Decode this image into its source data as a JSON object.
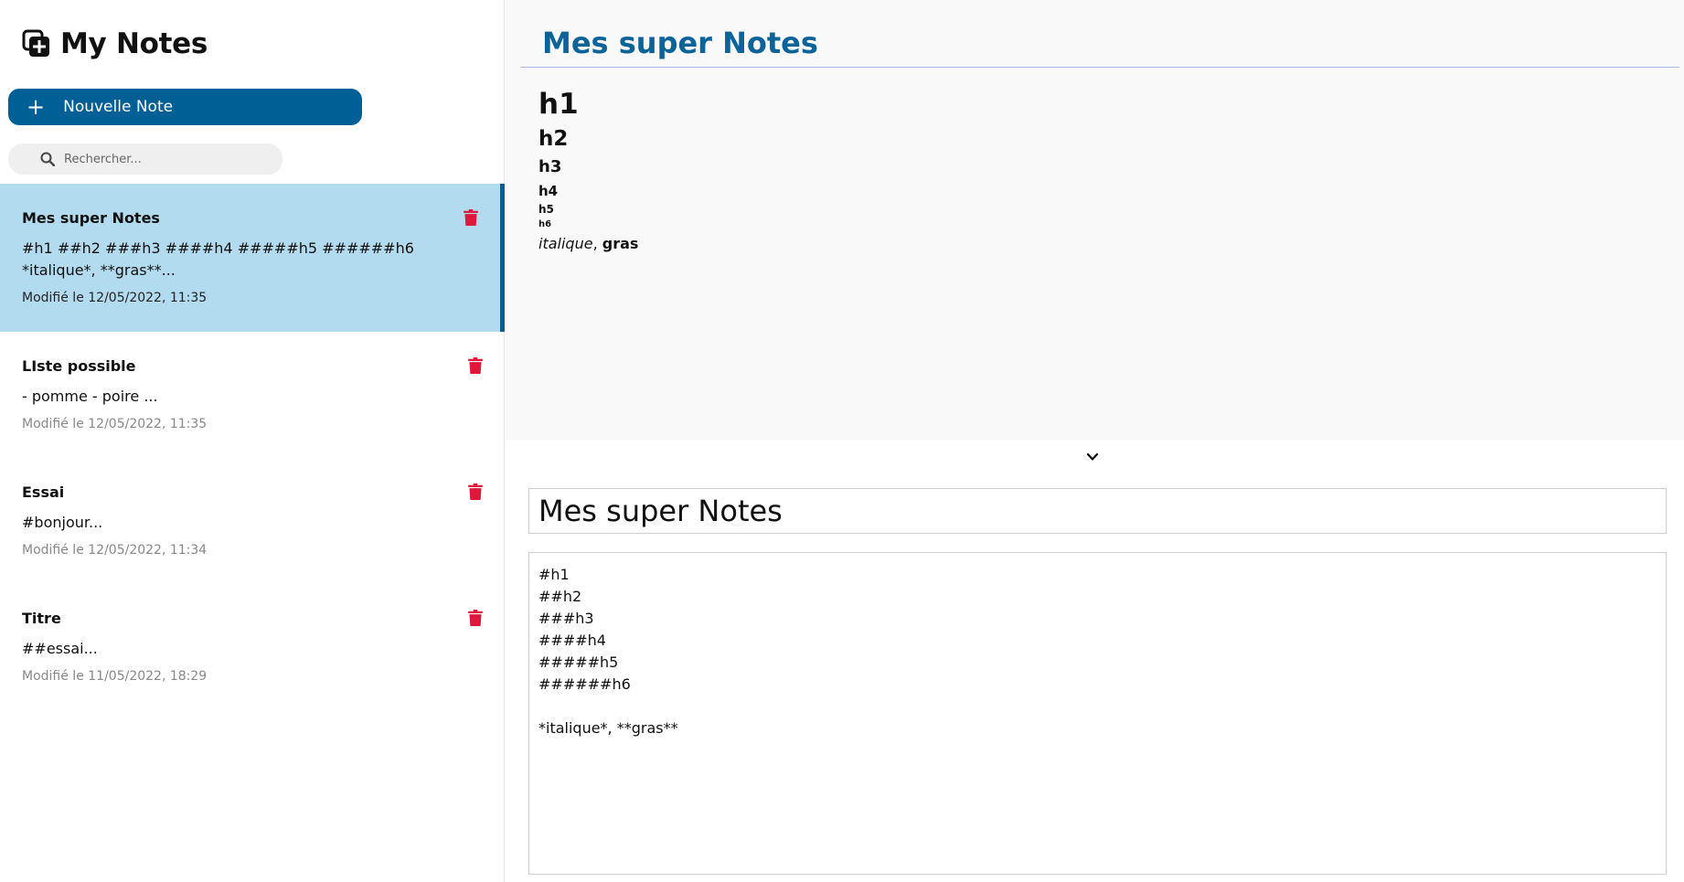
{
  "app": {
    "title": "My Notes"
  },
  "sidebar": {
    "new_note_label": "Nouvelle Note",
    "search_placeholder": "Rechercher...",
    "notes": [
      {
        "title": "Mes super Notes",
        "preview": "#h1 ##h2 ###h3 ####h4 #####h5 ######h6 *italique*, **gras**...",
        "modified": "Modifié le 12/05/2022, 11:35",
        "active": true
      },
      {
        "title": "LIste possible",
        "preview": "- pomme - poire ...",
        "modified": "Modifié le 12/05/2022, 11:35",
        "active": false
      },
      {
        "title": "Essai",
        "preview": "#bonjour...",
        "modified": "Modifié le 12/05/2022, 11:34",
        "active": false
      },
      {
        "title": "Titre",
        "preview": "##essai...",
        "modified": "Modifié le 11/05/2022, 18:29",
        "active": false
      }
    ]
  },
  "preview": {
    "title": "Mes super Notes",
    "h1": "h1",
    "h2": "h2",
    "h3": "h3",
    "h4": "h4",
    "h5": "h5",
    "h6": "h6",
    "italic": "italique",
    "separator": ", ",
    "bold": "gras"
  },
  "editor": {
    "title_value": "Mes super Notes",
    "content_value": "#h1\n##h2\n###h3\n####h4\n#####h5\n######h6\n\n*italique*, **gras**"
  },
  "colors": {
    "accent": "#005f95",
    "active_note_bg": "#b3dbef",
    "preview_title": "#0c6398",
    "trash": "#e0173c"
  },
  "icons": {
    "logo": "add-note-icon",
    "search": "search-icon",
    "trash": "trash-icon",
    "toggle": "chevron-down-icon",
    "plus": "plus-icon"
  }
}
